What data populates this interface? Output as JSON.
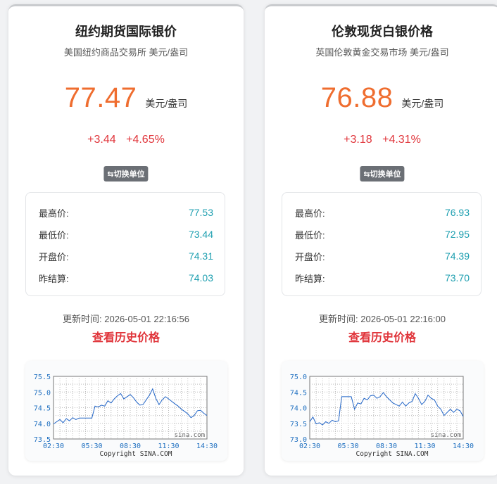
{
  "cards": [
    {
      "title": "纽约期货国际银价",
      "subtitle": "美国纽约商品交易所 美元/盎司",
      "price": "77.47",
      "unit": "美元/盎司",
      "change": "+3.44",
      "change_pct": "+4.65%",
      "switch_icon": "swap-arrows-icon",
      "switch_label": "切换单位",
      "stats": [
        {
          "label": "最高价:",
          "value": "77.53"
        },
        {
          "label": "最低价:",
          "value": "73.44"
        },
        {
          "label": "开盘价:",
          "value": "74.31"
        },
        {
          "label": "昨结算:",
          "value": "74.03"
        }
      ],
      "update_time": "更新时间: 2026-05-01 22:16:56",
      "history_link": "查看历史价格",
      "chart_data": {
        "type": "line",
        "x_ticks": [
          "02:30",
          "05:30",
          "08:30",
          "11:30",
          "14:30"
        ],
        "y_ticks": [
          "75.5",
          "75.0",
          "74.5",
          "74.0",
          "73.5"
        ],
        "ylim": [
          73.5,
          75.5
        ],
        "watermark": "sina.com",
        "copyright": "Copyright  SINA.COM",
        "series": [
          {
            "x": [
              "02:30",
              "02:45",
              "03:00",
              "03:15",
              "03:30",
              "03:45",
              "04:00",
              "04:15",
              "04:30",
              "04:45",
              "05:00",
              "05:15",
              "05:30",
              "05:45",
              "06:00",
              "06:15",
              "06:30",
              "06:45",
              "07:00",
              "07:15",
              "07:30",
              "07:45",
              "08:00",
              "08:15",
              "08:30",
              "08:45",
              "09:00",
              "09:15",
              "09:30",
              "09:45",
              "10:00",
              "10:15",
              "10:30",
              "10:45",
              "11:00",
              "11:15",
              "11:30",
              "11:45",
              "12:00",
              "12:15",
              "12:30",
              "12:45",
              "13:00",
              "13:15",
              "13:30",
              "13:45",
              "14:00",
              "14:15",
              "14:30"
            ],
            "values": [
              73.98,
              74.05,
              74.12,
              74.02,
              74.15,
              74.08,
              74.18,
              74.12,
              74.17,
              74.17,
              74.17,
              74.17,
              74.17,
              74.55,
              74.52,
              74.58,
              74.55,
              74.72,
              74.65,
              74.78,
              74.88,
              74.95,
              74.78,
              74.85,
              74.92,
              74.82,
              74.68,
              74.58,
              74.6,
              74.75,
              74.9,
              75.1,
              74.8,
              74.6,
              74.75,
              74.85,
              74.78,
              74.7,
              74.62,
              74.55,
              74.45,
              74.38,
              74.3,
              74.18,
              74.25,
              74.4,
              74.42,
              74.32,
              74.25
            ]
          }
        ]
      }
    },
    {
      "title": "伦敦现货白银价格",
      "subtitle": "英国伦敦黄金交易市场 美元/盎司",
      "price": "76.88",
      "unit": "美元/盎司",
      "change": "+3.18",
      "change_pct": "+4.31%",
      "switch_icon": "swap-arrows-icon",
      "switch_label": "切换单位",
      "stats": [
        {
          "label": "最高价:",
          "value": "76.93"
        },
        {
          "label": "最低价:",
          "value": "72.95"
        },
        {
          "label": "开盘价:",
          "value": "74.39"
        },
        {
          "label": "昨结算:",
          "value": "73.70"
        }
      ],
      "update_time": "更新时间: 2026-05-01 22:16:00",
      "history_link": "查看历史价格",
      "chart_data": {
        "type": "line",
        "x_ticks": [
          "02:30",
          "05:30",
          "08:30",
          "11:30",
          "14:30"
        ],
        "y_ticks": [
          "75.0",
          "74.5",
          "74.0",
          "73.5",
          "73.0"
        ],
        "ylim": [
          73.0,
          75.0
        ],
        "watermark": "sina.com",
        "copyright": "Copyright  SINA.COM",
        "series": [
          {
            "x": [
              "02:30",
              "02:45",
              "03:00",
              "03:15",
              "03:30",
              "03:45",
              "04:00",
              "04:15",
              "04:30",
              "04:45",
              "05:00",
              "05:15",
              "05:30",
              "05:45",
              "06:00",
              "06:15",
              "06:30",
              "06:45",
              "07:00",
              "07:15",
              "07:30",
              "07:45",
              "08:00",
              "08:15",
              "08:30",
              "08:45",
              "09:00",
              "09:15",
              "09:30",
              "09:45",
              "10:00",
              "10:15",
              "10:30",
              "10:45",
              "11:00",
              "11:15",
              "11:30",
              "11:45",
              "12:00",
              "12:15",
              "12:30",
              "12:45",
              "13:00",
              "13:15",
              "13:30",
              "13:45",
              "14:00",
              "14:15",
              "14:30"
            ],
            "values": [
              73.55,
              73.7,
              73.48,
              73.52,
              73.45,
              73.55,
              73.5,
              73.6,
              73.55,
              73.58,
              74.35,
              74.35,
              74.35,
              74.35,
              73.95,
              74.15,
              74.12,
              74.3,
              74.25,
              74.38,
              74.4,
              74.3,
              74.35,
              74.48,
              74.35,
              74.25,
              74.15,
              74.1,
              74.05,
              74.18,
              74.05,
              74.15,
              74.2,
              74.45,
              74.3,
              74.1,
              74.2,
              74.4,
              74.3,
              74.25,
              74.05,
              73.95,
              73.75,
              73.85,
              73.95,
              73.85,
              73.95,
              73.9,
              73.72
            ]
          }
        ]
      }
    }
  ]
}
